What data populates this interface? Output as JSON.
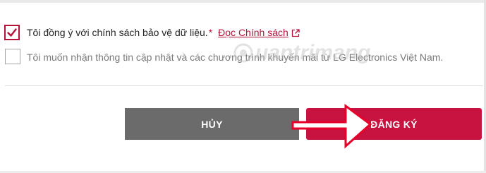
{
  "consent": {
    "privacy_label": "Tôi đồng ý với chính sách bảo vệ dữ liệu.",
    "required_marker": "*",
    "policy_link": "Đọc Chính sách",
    "privacy_checked": true,
    "marketing_label": "Tôi muốn nhận thông tin cập nhật và các chương trình khuyến mãi từ LG Electronics Việt Nam.",
    "marketing_checked": false
  },
  "actions": {
    "cancel_label": "HỦY",
    "register_label": "ĐĂNG KÝ"
  },
  "watermark": {
    "text": "uantrimang"
  },
  "icons": {
    "checkmark": "checkmark-icon",
    "external_link": "external-link-icon",
    "annotation_arrow": "right-arrow-icon"
  },
  "colors": {
    "accent": "#c8123f",
    "cancel_button": "#6b6b6b",
    "arrow": "#e6002a"
  }
}
